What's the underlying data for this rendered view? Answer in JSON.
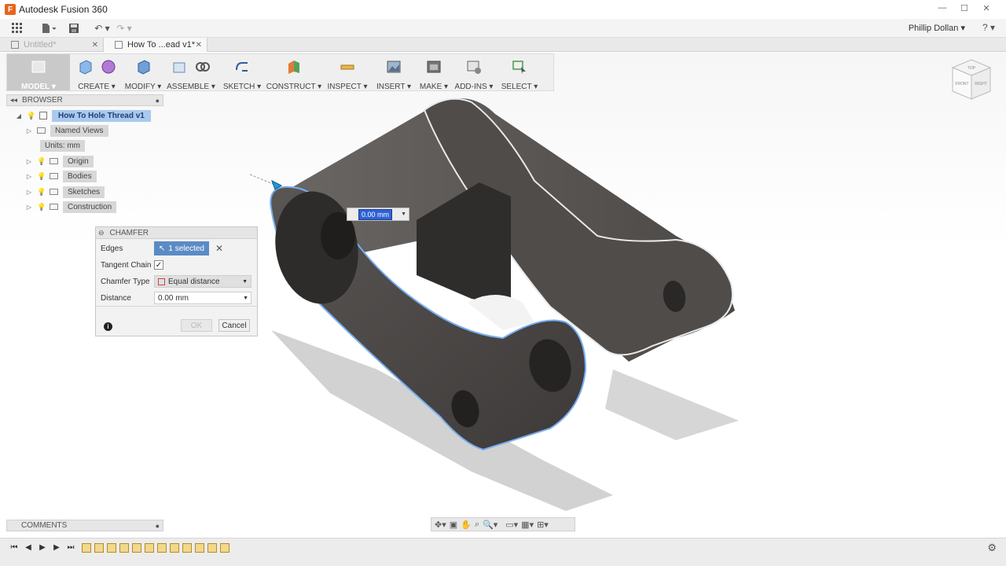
{
  "window": {
    "title": "Autodesk Fusion 360",
    "app_icon": "F",
    "controls": {
      "minimize": "—",
      "maximize": "☐",
      "close": "✕"
    }
  },
  "qat": {
    "user": "Phillip Dollan ▾",
    "help": "? ▾"
  },
  "tabs": [
    {
      "label": "Untitled*",
      "close": "✕"
    },
    {
      "label": "How To ...ead v1*",
      "close": "✕"
    }
  ],
  "ribbon": {
    "model": "MODEL ▾",
    "groups": [
      {
        "label": "CREATE ▾"
      },
      {
        "label": "MODIFY ▾"
      },
      {
        "label": "ASSEMBLE ▾"
      },
      {
        "label": "SKETCH ▾"
      },
      {
        "label": "CONSTRUCT ▾"
      },
      {
        "label": "INSPECT ▾"
      },
      {
        "label": "INSERT ▾"
      },
      {
        "label": "MAKE ▾"
      },
      {
        "label": "ADD-INS ▾"
      },
      {
        "label": "SELECT ▾"
      }
    ]
  },
  "browser": {
    "title": "BROWSER",
    "root": "How To Hole Thread v1",
    "items": [
      {
        "label": "Named Views"
      },
      {
        "label": "Units: mm"
      },
      {
        "label": "Origin"
      },
      {
        "label": "Bodies"
      },
      {
        "label": "Sketches"
      },
      {
        "label": "Construction"
      }
    ]
  },
  "chamfer": {
    "title": "CHAMFER",
    "edges_label": "Edges",
    "edges_value": "1 selected",
    "tangent_label": "Tangent Chain",
    "tangent_checked": "✓",
    "type_label": "Chamfer Type",
    "type_value": "Equal distance",
    "distance_label": "Distance",
    "distance_value": "0.00 mm",
    "ok": "OK",
    "cancel": "Cancel",
    "info": "i"
  },
  "canvas_input": {
    "value": "0.00 mm"
  },
  "viewcube": {
    "top": "TOP",
    "front": "FRONT",
    "right": "RIGHT"
  },
  "comments": {
    "title": "COMMENTS"
  },
  "colors": {
    "accent": "#5b8bc6",
    "selection_edge": "#6fa8e8",
    "body": "#4a4745"
  }
}
